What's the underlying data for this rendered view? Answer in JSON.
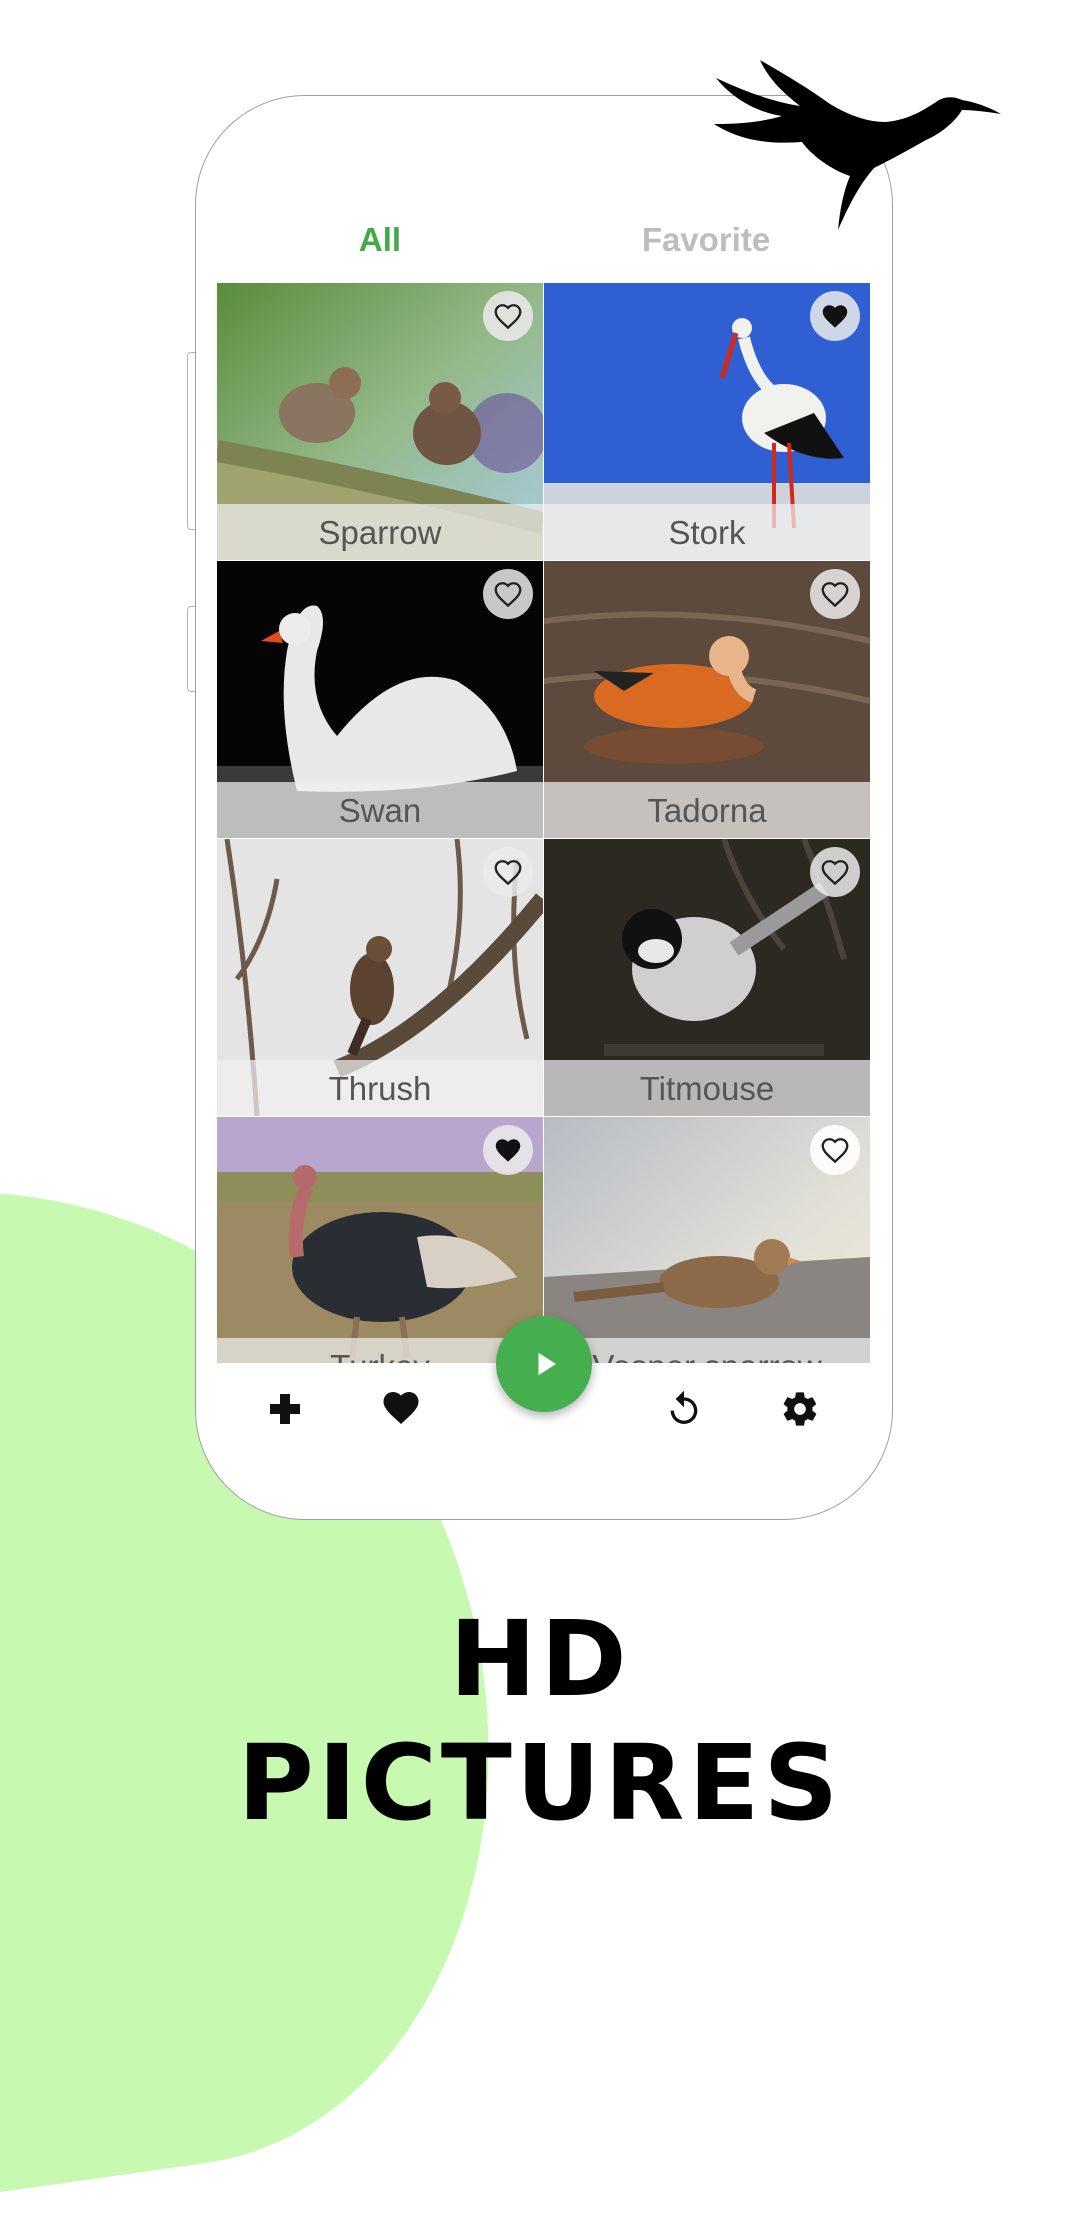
{
  "tabs": [
    {
      "label": "All",
      "active": true,
      "color": "#43a94c"
    },
    {
      "label": "Favorite",
      "active": false,
      "color": "#bdbdbd"
    }
  ],
  "birds": [
    {
      "name": "Sparrow",
      "favorite": false
    },
    {
      "name": "Stork",
      "favorite": true
    },
    {
      "name": "Swan",
      "favorite": false
    },
    {
      "name": "Tadorna",
      "favorite": false
    },
    {
      "name": "Thrush",
      "favorite": false
    },
    {
      "name": "Titmouse",
      "favorite": false
    },
    {
      "name": "Turkey",
      "favorite": true
    },
    {
      "name": "Vesper sparrow",
      "favorite": false
    }
  ],
  "bottom_nav": {
    "items": [
      "gamepad-icon",
      "heart-icon",
      "play-icon",
      "replay-icon",
      "settings-icon"
    ]
  },
  "promo": {
    "line1": "HD",
    "line2": "PICTURES"
  },
  "colors": {
    "accent": "#45ae4e",
    "blob": "#c8f9b0"
  }
}
